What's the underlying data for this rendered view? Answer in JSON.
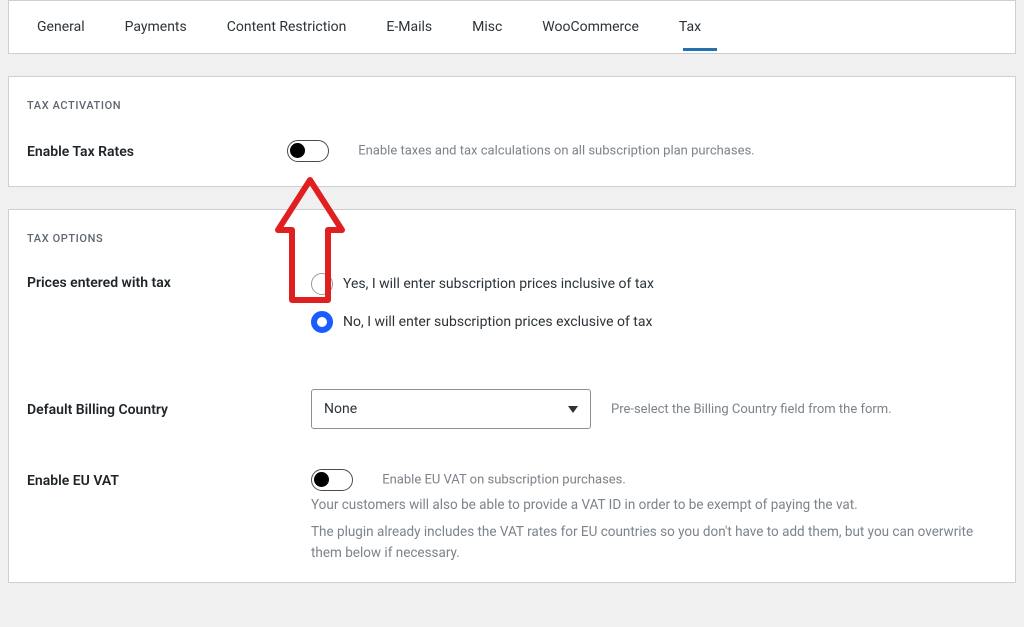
{
  "tabs": {
    "items": [
      {
        "label": "General"
      },
      {
        "label": "Payments"
      },
      {
        "label": "Content Restriction"
      },
      {
        "label": "E-Mails"
      },
      {
        "label": "Misc"
      },
      {
        "label": "WooCommerce"
      },
      {
        "label": "Tax"
      }
    ],
    "active": 6
  },
  "activation": {
    "title": "TAX ACTIVATION",
    "enable_label": "Enable Tax Rates",
    "enable_desc": "Enable taxes and tax calculations on all subscription plan purchases."
  },
  "options": {
    "title": "TAX OPTIONS",
    "prices_label": "Prices entered with tax",
    "price_opt_inclusive": "Yes, I will enter subscription prices inclusive of tax",
    "price_opt_exclusive": "No, I will enter subscription prices exclusive of tax",
    "billing_label": "Default Billing Country",
    "billing_value": "None",
    "billing_desc": "Pre-select the Billing Country field from the form.",
    "euvat_label": "Enable EU VAT",
    "euvat_desc": "Enable EU VAT on subscription purchases.",
    "euvat_note1": "Your customers will also be able to provide a VAT ID in order to be exempt of paying the vat.",
    "euvat_note2": "The plugin already includes the VAT rates for EU countries so you don't have to add them, but you can overwrite them below if necessary."
  }
}
